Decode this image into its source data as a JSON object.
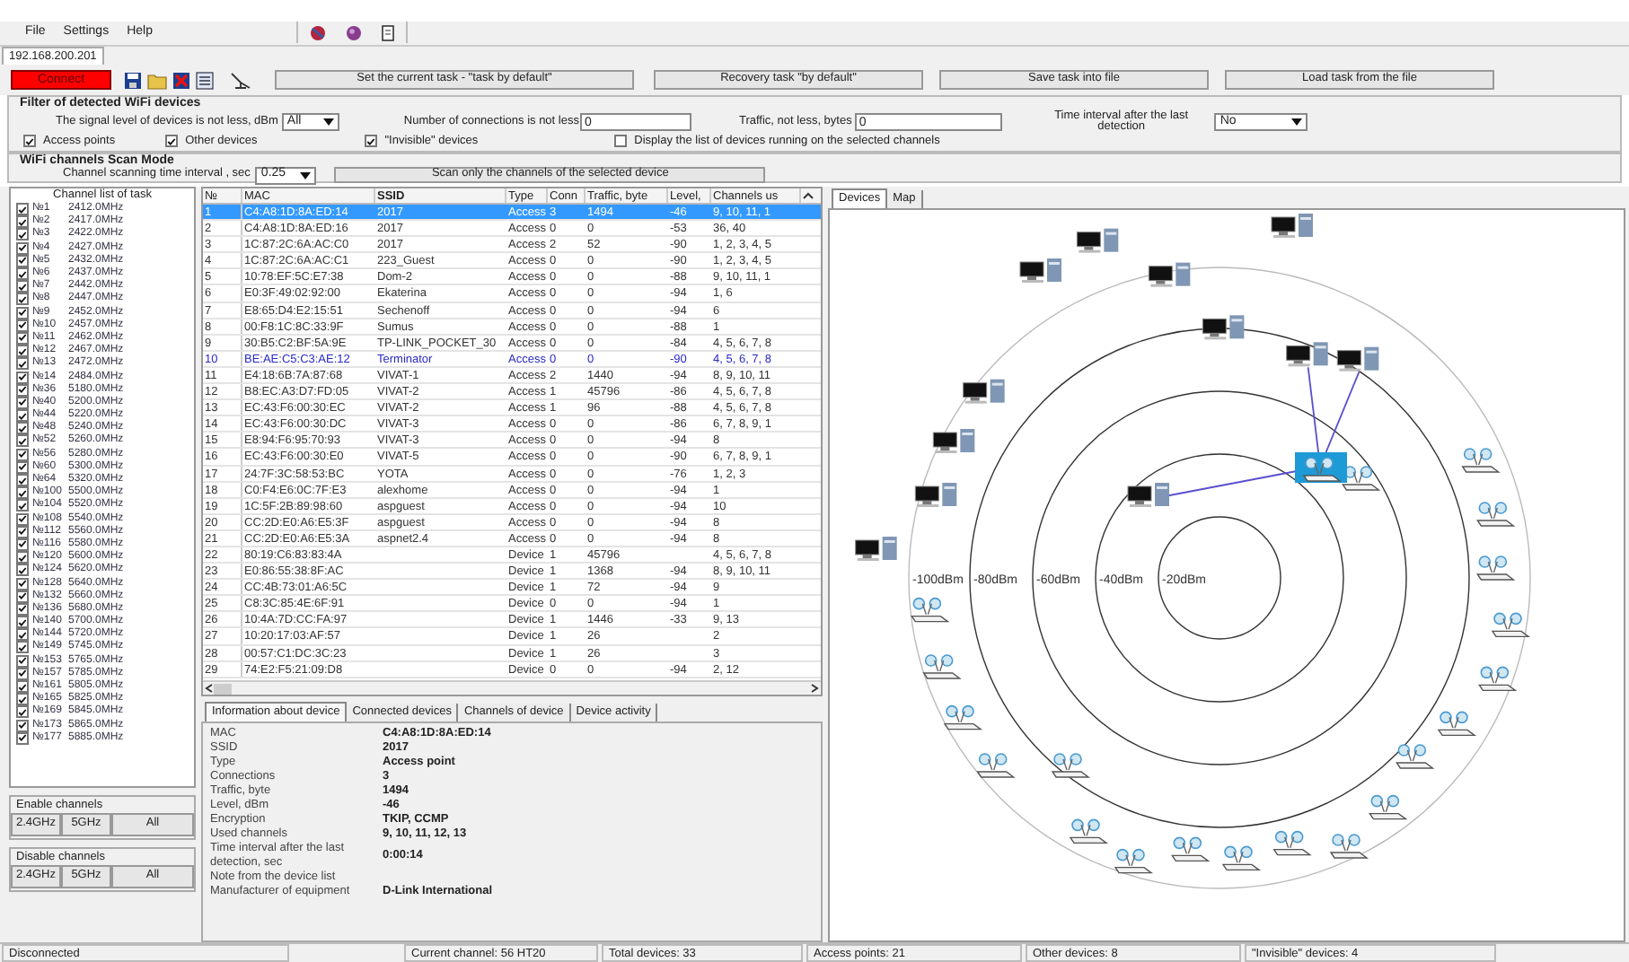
{
  "menu": [
    "File",
    "Settings",
    "Help"
  ],
  "address_tab": "192.168.200.201",
  "connect_button": "Connect",
  "task_buttons": [
    "Set the current task - \"task by default\"",
    "Recovery task \"by default\"",
    "Save task into file",
    "Load task from the file"
  ],
  "filter": {
    "title": "Filter of detected WiFi devices",
    "signal_label": "The signal level of devices is not less, dBm",
    "signal_value": "All",
    "connections_label": "Number of connections is not less",
    "connections_value": "0",
    "traffic_label": "Traffic, not less, bytes",
    "traffic_value": "0",
    "interval_label": "Time interval after the last detection",
    "interval_value": "No",
    "checkboxes": [
      {
        "label": "Access points",
        "checked": true
      },
      {
        "label": "Other devices",
        "checked": true
      },
      {
        "label": "\"Invisible\" devices",
        "checked": true
      },
      {
        "label": "Display the list of devices running on the selected channels",
        "checked": false
      }
    ]
  },
  "scan": {
    "title": "WiFi channels Scan Mode",
    "interval_label": "Channel scanning time interval , sec",
    "interval_value": "0.25",
    "button": "Scan only the channels of the selected device"
  },
  "channels": {
    "title": "Channel list of task",
    "items": [
      {
        "number": "№1",
        "freq": "2412.0MHz",
        "checked": true
      },
      {
        "number": "№2",
        "freq": "2417.0MHz",
        "checked": true
      },
      {
        "number": "№3",
        "freq": "2422.0MHz",
        "checked": true
      },
      {
        "number": "№4",
        "freq": "2427.0MHz",
        "checked": true
      },
      {
        "number": "№5",
        "freq": "2432.0MHz",
        "checked": true
      },
      {
        "number": "№6",
        "freq": "2437.0MHz",
        "checked": true
      },
      {
        "number": "№7",
        "freq": "2442.0MHz",
        "checked": true
      },
      {
        "number": "№8",
        "freq": "2447.0MHz",
        "checked": true
      },
      {
        "number": "№9",
        "freq": "2452.0MHz",
        "checked": true
      },
      {
        "number": "№10",
        "freq": "2457.0MHz",
        "checked": true
      },
      {
        "number": "№11",
        "freq": "2462.0MHz",
        "checked": true
      },
      {
        "number": "№12",
        "freq": "2467.0MHz",
        "checked": true
      },
      {
        "number": "№13",
        "freq": "2472.0MHz",
        "checked": true
      },
      {
        "number": "№14",
        "freq": "2484.0MHz",
        "checked": true
      },
      {
        "number": "№36",
        "freq": "5180.0MHz",
        "checked": true
      },
      {
        "number": "№40",
        "freq": "5200.0MHz",
        "checked": true
      },
      {
        "number": "№44",
        "freq": "5220.0MHz",
        "checked": true
      },
      {
        "number": "№48",
        "freq": "5240.0MHz",
        "checked": true
      },
      {
        "number": "№52",
        "freq": "5260.0MHz",
        "checked": true
      },
      {
        "number": "№56",
        "freq": "5280.0MHz",
        "checked": true
      },
      {
        "number": "№60",
        "freq": "5300.0MHz",
        "checked": true
      },
      {
        "number": "№64",
        "freq": "5320.0MHz",
        "checked": true
      },
      {
        "number": "№100",
        "freq": "5500.0MHz",
        "checked": true
      },
      {
        "number": "№104",
        "freq": "5520.0MHz",
        "checked": true
      },
      {
        "number": "№108",
        "freq": "5540.0MHz",
        "checked": true
      },
      {
        "number": "№112",
        "freq": "5560.0MHz",
        "checked": true
      },
      {
        "number": "№116",
        "freq": "5580.0MHz",
        "checked": true
      },
      {
        "number": "№120",
        "freq": "5600.0MHz",
        "checked": true
      },
      {
        "number": "№124",
        "freq": "5620.0MHz",
        "checked": true
      },
      {
        "number": "№128",
        "freq": "5640.0MHz",
        "checked": true
      },
      {
        "number": "№132",
        "freq": "5660.0MHz",
        "checked": true
      },
      {
        "number": "№136",
        "freq": "5680.0MHz",
        "checked": true
      },
      {
        "number": "№140",
        "freq": "5700.0MHz",
        "checked": true
      },
      {
        "number": "№144",
        "freq": "5720.0MHz",
        "checked": true
      },
      {
        "number": "№149",
        "freq": "5745.0MHz",
        "checked": true
      },
      {
        "number": "№153",
        "freq": "5765.0MHz",
        "checked": true
      },
      {
        "number": "№157",
        "freq": "5785.0MHz",
        "checked": true
      },
      {
        "number": "№161",
        "freq": "5805.0MHz",
        "checked": true
      },
      {
        "number": "№165",
        "freq": "5825.0MHz",
        "checked": true
      },
      {
        "number": "№169",
        "freq": "5845.0MHz",
        "checked": true
      },
      {
        "number": "№173",
        "freq": "5865.0MHz",
        "checked": true
      },
      {
        "number": "№177",
        "freq": "5885.0MHz",
        "checked": true
      }
    ],
    "enable": {
      "title": "Enable channels",
      "buttons": [
        "2.4GHz",
        "5GHz",
        "All"
      ]
    },
    "disable": {
      "title": "Disable channels",
      "buttons": [
        "2.4GHz",
        "5GHz",
        "All"
      ]
    }
  },
  "table": {
    "columns": [
      "№",
      "MAC",
      "SSID",
      "Type",
      "Conn",
      "Traffic, byte",
      "Level,",
      "Channels us"
    ],
    "rows": [
      {
        "n": "1",
        "mac": "C4:A8:1D:8A:ED:14",
        "ssid": "2017",
        "type": "Access",
        "conn": "3",
        "traffic": "1494",
        "level": "-46",
        "channels": "9, 10, 11, 1",
        "selected": true,
        "invisible": false
      },
      {
        "n": "2",
        "mac": "C4:A8:1D:8A:ED:16",
        "ssid": "2017",
        "type": "Access",
        "conn": "0",
        "traffic": "0",
        "level": "-53",
        "channels": "36, 40",
        "selected": false,
        "invisible": false
      },
      {
        "n": "3",
        "mac": "1C:87:2C:6A:AC:C0",
        "ssid": "2017",
        "type": "Access",
        "conn": "2",
        "traffic": "52",
        "level": "-90",
        "channels": "1, 2, 3, 4, 5",
        "selected": false,
        "invisible": false
      },
      {
        "n": "4",
        "mac": "1C:87:2C:6A:AC:C1",
        "ssid": "223_Guest",
        "type": "Access",
        "conn": "0",
        "traffic": "0",
        "level": "-90",
        "channels": "1, 2, 3, 4, 5",
        "selected": false,
        "invisible": false
      },
      {
        "n": "5",
        "mac": "10:78:EF:5C:E7:38",
        "ssid": "Dom-2",
        "type": "Access",
        "conn": "0",
        "traffic": "0",
        "level": "-88",
        "channels": "9, 10, 11, 1",
        "selected": false,
        "invisible": false
      },
      {
        "n": "6",
        "mac": "E0:3F:49:02:92:00",
        "ssid": "Ekaterina",
        "type": "Access",
        "conn": "0",
        "traffic": "0",
        "level": "-94",
        "channels": "1, 6",
        "selected": false,
        "invisible": false
      },
      {
        "n": "7",
        "mac": "E8:65:D4:E2:15:51",
        "ssid": "Sechenoff",
        "type": "Access",
        "conn": "0",
        "traffic": "0",
        "level": "-94",
        "channels": "6",
        "selected": false,
        "invisible": false
      },
      {
        "n": "8",
        "mac": "00:F8:1C:8C:33:9F",
        "ssid": "Sumus",
        "type": "Access",
        "conn": "0",
        "traffic": "0",
        "level": "-88",
        "channels": "1",
        "selected": false,
        "invisible": false
      },
      {
        "n": "9",
        "mac": "30:B5:C2:BF:5A:9E",
        "ssid": "TP-LINK_POCKET_30",
        "type": "Access",
        "conn": "0",
        "traffic": "0",
        "level": "-84",
        "channels": "4, 5, 6, 7, 8",
        "selected": false,
        "invisible": false
      },
      {
        "n": "10",
        "mac": "BE:AE:C5:C3:AE:12",
        "ssid": "Terminator",
        "type": "Access",
        "conn": "0",
        "traffic": "0",
        "level": "-90",
        "channels": "4, 5, 6, 7, 8",
        "selected": false,
        "invisible": true
      },
      {
        "n": "11",
        "mac": "E4:18:6B:7A:87:68",
        "ssid": "VIVAT-1",
        "type": "Access",
        "conn": "2",
        "traffic": "1440",
        "level": "-94",
        "channels": "8, 9, 10, 11",
        "selected": false,
        "invisible": false
      },
      {
        "n": "12",
        "mac": "B8:EC:A3:D7:FD:05",
        "ssid": "VIVAT-2",
        "type": "Access",
        "conn": "1",
        "traffic": "45796",
        "level": "-86",
        "channels": "4, 5, 6, 7, 8",
        "selected": false,
        "invisible": false
      },
      {
        "n": "13",
        "mac": "EC:43:F6:00:30:EC",
        "ssid": "VIVAT-2",
        "type": "Access",
        "conn": "1",
        "traffic": "96",
        "level": "-88",
        "channels": "4, 5, 6, 7, 8",
        "selected": false,
        "invisible": false
      },
      {
        "n": "14",
        "mac": "EC:43:F6:00:30:DC",
        "ssid": "VIVAT-3",
        "type": "Access",
        "conn": "0",
        "traffic": "0",
        "level": "-86",
        "channels": "6, 7, 8, 9, 1",
        "selected": false,
        "invisible": false
      },
      {
        "n": "15",
        "mac": "E8:94:F6:95:70:93",
        "ssid": "VIVAT-3",
        "type": "Access",
        "conn": "0",
        "traffic": "0",
        "level": "-94",
        "channels": "8",
        "selected": false,
        "invisible": false
      },
      {
        "n": "16",
        "mac": "EC:43:F6:00:30:E0",
        "ssid": "VIVAT-5",
        "type": "Access",
        "conn": "0",
        "traffic": "0",
        "level": "-90",
        "channels": "6, 7, 8, 9, 1",
        "selected": false,
        "invisible": false
      },
      {
        "n": "17",
        "mac": "24:7F:3C:58:53:BC",
        "ssid": "YOTA",
        "type": "Access",
        "conn": "0",
        "traffic": "0",
        "level": "-76",
        "channels": "1, 2, 3",
        "selected": false,
        "invisible": false
      },
      {
        "n": "18",
        "mac": "C0:F4:E6:0C:7F:E3",
        "ssid": "alexhome",
        "type": "Access",
        "conn": "0",
        "traffic": "0",
        "level": "-94",
        "channels": "1",
        "selected": false,
        "invisible": false
      },
      {
        "n": "19",
        "mac": "1C:5F:2B:89:98:60",
        "ssid": "aspguest",
        "type": "Access",
        "conn": "0",
        "traffic": "0",
        "level": "-94",
        "channels": "10",
        "selected": false,
        "invisible": false
      },
      {
        "n": "20",
        "mac": "CC:2D:E0:A6:E5:3F",
        "ssid": "aspguest",
        "type": "Access",
        "conn": "0",
        "traffic": "0",
        "level": "-94",
        "channels": "8",
        "selected": false,
        "invisible": false
      },
      {
        "n": "21",
        "mac": "CC:2D:E0:A6:E5:3A",
        "ssid": "aspnet2.4",
        "type": "Access",
        "conn": "0",
        "traffic": "0",
        "level": "-94",
        "channels": "8",
        "selected": false,
        "invisible": false
      },
      {
        "n": "22",
        "mac": "80:19:C6:83:83:4A",
        "type": "Device",
        "conn": "1",
        "traffic": "45796",
        "channels": "4, 5, 6, 7, 8",
        "selected": false,
        "invisible": false
      },
      {
        "n": "23",
        "mac": "E0:86:55:38:8F:AC",
        "type": "Device",
        "conn": "1",
        "traffic": "1368",
        "level": "-94",
        "channels": "8, 9, 10, 11",
        "selected": false,
        "invisible": false
      },
      {
        "n": "24",
        "mac": "CC:4B:73:01:A6:5C",
        "type": "Device",
        "conn": "1",
        "traffic": "72",
        "level": "-94",
        "channels": "9",
        "selected": false,
        "invisible": false
      },
      {
        "n": "25",
        "mac": "C8:3C:85:4E:6F:91",
        "type": "Device",
        "conn": "0",
        "traffic": "0",
        "level": "-94",
        "channels": "1",
        "selected": false,
        "invisible": false
      },
      {
        "n": "26",
        "mac": "10:4A:7D:CC:FA:97",
        "type": "Device",
        "conn": "1",
        "traffic": "1446",
        "level": "-33",
        "channels": "9, 13",
        "selected": false,
        "invisible": false
      },
      {
        "n": "27",
        "mac": "10:20:17:03:AF:57",
        "type": "Device",
        "conn": "1",
        "traffic": "26",
        "channels": "2",
        "selected": false,
        "invisible": false
      },
      {
        "n": "28",
        "mac": "00:57:C1:DC:3C:23",
        "type": "Device",
        "conn": "1",
        "traffic": "26",
        "channels": "3",
        "selected": false,
        "invisible": false
      },
      {
        "n": "29",
        "mac": "74:E2:F5:21:09:D8",
        "type": "Device",
        "conn": "0",
        "traffic": "0",
        "level": "-94",
        "channels": "2, 12",
        "selected": false,
        "invisible": false
      }
    ]
  },
  "info": {
    "tabs": [
      {
        "label": "Information about device",
        "selected": true
      },
      {
        "label": "Connected devices",
        "selected": false
      },
      {
        "label": "Channels of device",
        "selected": false
      },
      {
        "label": "Device activity",
        "selected": false
      }
    ],
    "fields": [
      {
        "label": "MAC",
        "value": "C4:A8:1D:8A:ED:14"
      },
      {
        "label": "SSID",
        "value": "2017"
      },
      {
        "label": "Type",
        "value": "Access point"
      },
      {
        "label": "Connections",
        "value": "3"
      },
      {
        "label": "Traffic, byte",
        "value": "1494"
      },
      {
        "label": "Level, dBm",
        "value": "-46"
      },
      {
        "label": "Encryption",
        "value": "TKIP, CCMP"
      },
      {
        "label": "Used channels",
        "value": "9, 10, 11, 12, 13"
      },
      {
        "label": "Time interval after the last detection, sec",
        "value": "0:00:14"
      },
      {
        "label": "Note from the device list"
      },
      {
        "label": "Manufacturer of equipment",
        "value": "D-Link International"
      }
    ]
  },
  "map_panel": {
    "tabs": [
      {
        "label": "Devices",
        "selected": true
      },
      {
        "label": "Map",
        "selected": false
      }
    ],
    "ring_labels": [
      "-100dBm",
      "-80dBm",
      "-60dBm",
      "-40dBm",
      "-20dBm"
    ]
  },
  "status_bar": [
    "Disconnected",
    "Current channel: 56 HT20",
    "Total devices: 33",
    "Access points: 21",
    "Other devices: 8",
    "\"Invisible\" devices: 4"
  ]
}
